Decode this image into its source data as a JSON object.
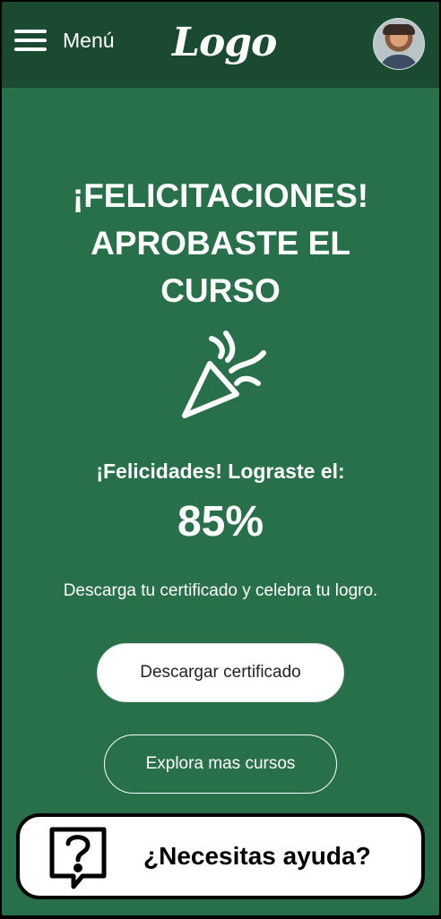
{
  "header": {
    "menu_label": "Menú",
    "logo_text": "Logo",
    "avatar_icon": "user-avatar"
  },
  "main": {
    "title_line1": "¡FELICITACIONES!",
    "title_line2": "APROBASTE EL",
    "title_line3": "CURSO",
    "celebration_icon": "party-popper-icon",
    "subtitle": "¡Felicidades! Lograste el:",
    "score": "85%",
    "description": "Descarga tu certificado y celebra tu logro.",
    "download_button": "Descargar certificado",
    "explore_button": "Explora mas cursos"
  },
  "help": {
    "icon": "question-bubble-icon",
    "label": "¿Necesitas ayuda?"
  },
  "colors": {
    "background": "#27704a",
    "header": "#1a4a30",
    "text": "#ffffff"
  }
}
